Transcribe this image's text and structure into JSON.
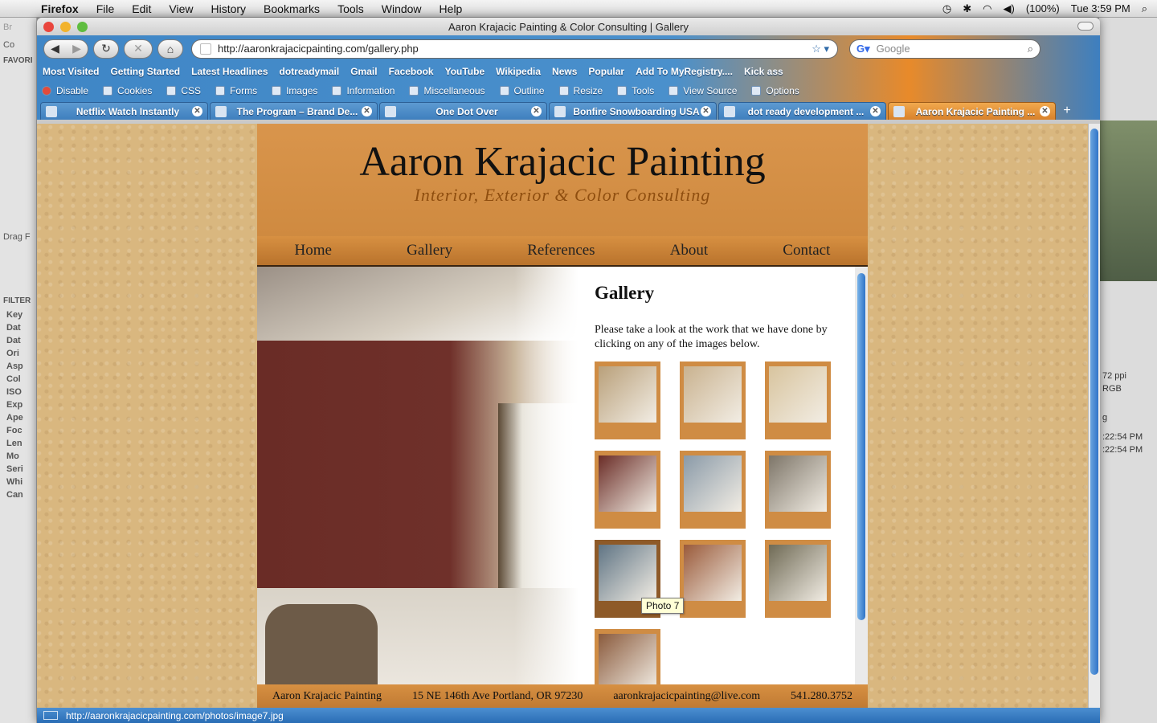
{
  "menubar": {
    "app": "Firefox",
    "items": [
      "File",
      "Edit",
      "View",
      "History",
      "Bookmarks",
      "Tools",
      "Window",
      "Help"
    ],
    "battery": "(100%)",
    "clock": "Tue 3:59 PM"
  },
  "window": {
    "title": "Aaron Krajacic Painting & Color Consulting | Gallery"
  },
  "navbar": {
    "url": "http://aaronkrajacicpainting.com/gallery.php",
    "search_placeholder": "Google"
  },
  "bookmarks": [
    "Most Visited",
    "Getting Started",
    "Latest Headlines",
    "dotreadymail",
    "Gmail",
    "Facebook",
    "YouTube",
    "Wikipedia",
    "News",
    "Popular",
    "Add To MyRegistry....",
    "Kick ass"
  ],
  "webdev": [
    "Disable",
    "Cookies",
    "CSS",
    "Forms",
    "Images",
    "Information",
    "Miscellaneous",
    "Outline",
    "Resize",
    "Tools",
    "View Source",
    "Options"
  ],
  "tabs": [
    {
      "label": "Netflix Watch Instantly"
    },
    {
      "label": "The Program – Brand De..."
    },
    {
      "label": "One Dot Over"
    },
    {
      "label": "Bonfire Snowboarding USA"
    },
    {
      "label": "dot ready development ..."
    },
    {
      "label": "Aaron Krajacic Painting ..."
    }
  ],
  "site": {
    "title": "Aaron Krajacic Painting",
    "tagline": "Interior, Exterior & Color Consulting",
    "nav": [
      "Home",
      "Gallery",
      "References",
      "About",
      "Contact"
    ],
    "gallery_heading": "Gallery",
    "gallery_intro": "Please take a look at the work that we have done by clicking on any of the images below.",
    "tooltip": "Photo 7",
    "footer": {
      "name": "Aaron Krajacic Painting",
      "address": "15 NE 146th Ave Portland, OR 97230",
      "email": "aaronkrajacicpainting@live.com",
      "phone": "541.280.3752"
    }
  },
  "thumb_colors": [
    "#b9a07a",
    "#c9b28f",
    "#d8c49e",
    "#6a2c26",
    "#8a9aa8",
    "#7d7568",
    "#5f7484",
    "#9a5a3a",
    "#6f6a55",
    "#8a5a3c"
  ],
  "statusbar": {
    "text": "http://aaronkrajacicpainting.com/photos/image7.jpg"
  },
  "bg_app": {
    "left_labels": [
      "Co",
      "FAVORI",
      "Drag F",
      "FILTER",
      "Key",
      "Dat",
      "Dat",
      "Ori",
      "Asp",
      "Col",
      "ISO",
      "Exp",
      "Ape",
      "Foc",
      "Len",
      "Mo",
      "Seri",
      "Whi",
      "Can"
    ],
    "right_labels": [
      "72 ppi",
      "RGB",
      "g",
      ":22:54 PM",
      ":22:54 PM"
    ]
  }
}
